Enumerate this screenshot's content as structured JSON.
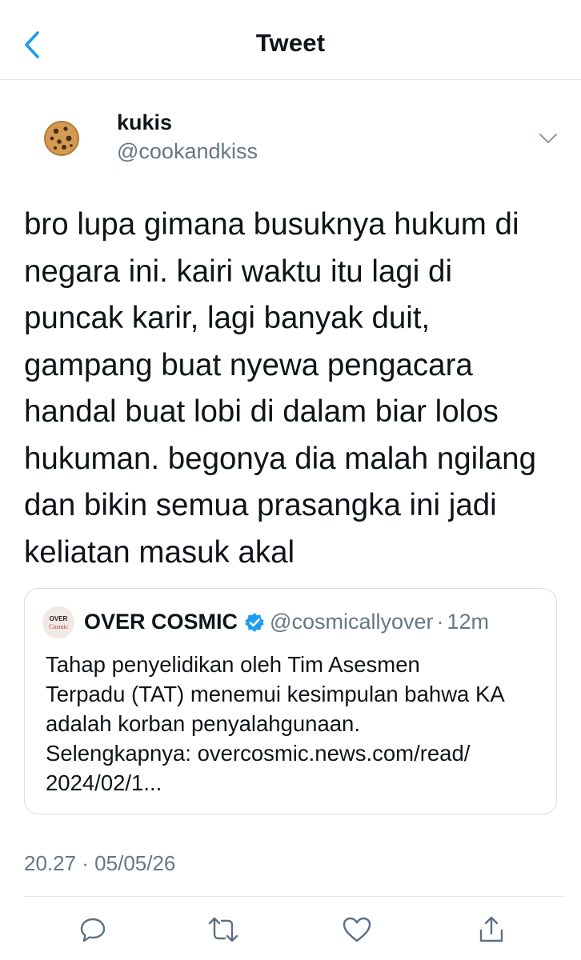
{
  "header": {
    "title": "Tweet",
    "back_icon": "chevron-left-icon",
    "accent_color": "#1d9bf0"
  },
  "tweet": {
    "author_name": "kukis",
    "author_handle": "@cookandkiss",
    "avatar_icon": "cookie-avatar",
    "more_icon": "chevron-down-icon",
    "text": "bro lupa gimana busuknya hukum di\nnegara ini. kairi waktu itu lagi di\npuncak karir, lagi banyak duit,\ngampang buat nyewa pengacara\nhandal buat lobi di dalam biar lolos\nhukuman. begonya dia malah ngilang\ndan bikin semua prasangka ini jadi\nkeliatan masuk akal",
    "timestamp": "20.27 · 05/05/26"
  },
  "quoted_tweet": {
    "avatar_label": "OVERCosmic",
    "author_name": "OVER COSMIC",
    "verified_icon": "verified-badge-icon",
    "author_handle": "@cosmicallyover",
    "separator": "·",
    "time": "12m",
    "text": "Tahap penyelidikan oleh Tim Asesmen\nTerpadu (TAT) menemui kesimpulan bahwa KA\nadalah korban penyalahgunaan.\nSelengkapnya: overcosmic.news.com/read/\n2024/02/1..."
  },
  "actions": [
    {
      "icon": "reply-icon"
    },
    {
      "icon": "retweet-icon"
    },
    {
      "icon": "like-icon"
    },
    {
      "icon": "share-icon"
    }
  ],
  "colors": {
    "text": "#0f1419",
    "secondary": "#657786",
    "icon": "#5b7083",
    "border": "#d8dfe4"
  }
}
